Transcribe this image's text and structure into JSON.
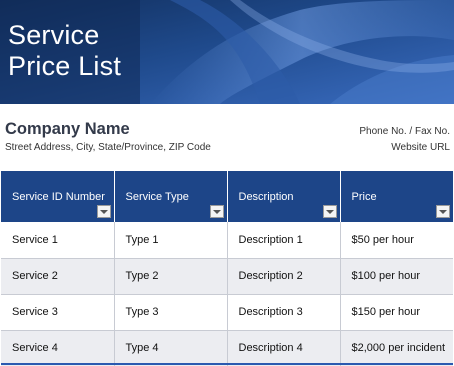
{
  "banner": {
    "title_line1": "Service",
    "title_line2": "Price List"
  },
  "company": {
    "name": "Company Name",
    "address": "Street Address, City, State/Province, ZIP Code",
    "phone_fax": "Phone No. / Fax No.",
    "website": "Website URL"
  },
  "table": {
    "headers": [
      "Service ID Number",
      "Service Type",
      "Description",
      "Price"
    ],
    "rows": [
      [
        "Service 1",
        "Type 1",
        "Description 1",
        "$50 per hour"
      ],
      [
        "Service 2",
        "Type 2",
        "Description 2",
        "$100 per hour"
      ],
      [
        "Service 3",
        "Type 3",
        "Description 3",
        "$150 per hour"
      ],
      [
        "Service 4",
        "Type 4",
        "Description 4",
        "$2,000 per incident"
      ]
    ]
  },
  "colors": {
    "header_blue": "#1d4588",
    "banner_blue": "#1f4a8c",
    "stripe_gray": "#ecedf1"
  },
  "icons": {
    "filter": "dropdown-filter-icon"
  }
}
